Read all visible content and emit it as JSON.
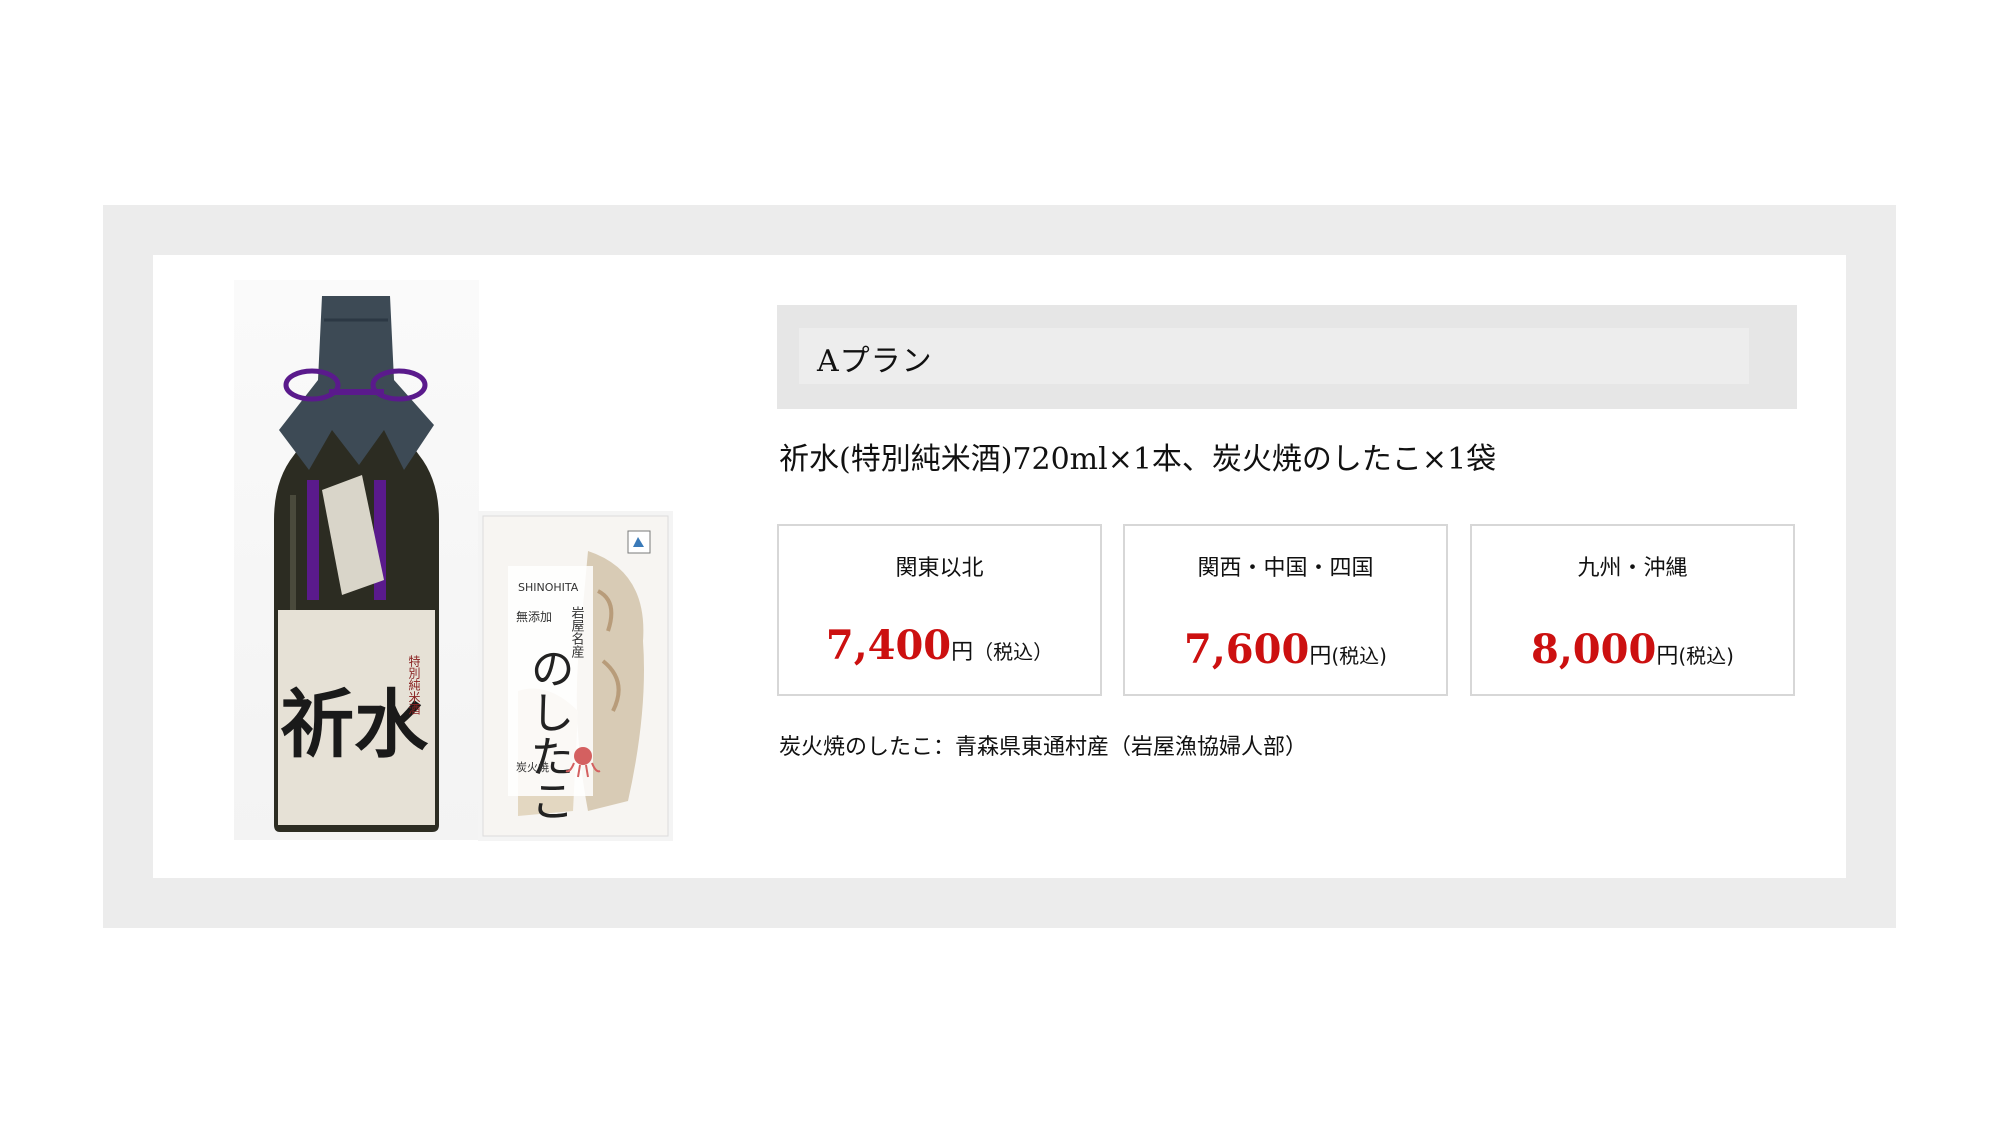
{
  "plan": {
    "title": "Aプラン",
    "description": "祈水(特別純米酒)720ml×1本、炭火焼のしたこ×1袋"
  },
  "prices": [
    {
      "region": "関東以北",
      "amount": "7,400",
      "unit": "円",
      "tax": "（税込）"
    },
    {
      "region": "関西・中国・四国",
      "amount": "7,600",
      "unit": "円",
      "tax": "(税込)"
    },
    {
      "region": "九州・沖縄",
      "amount": "8,000",
      "unit": "円",
      "tax": "(税込)"
    }
  ],
  "origin_note": "炭火焼のしたこ：青森県東通村産（岩屋漁協婦人部）",
  "bottle_label": {
    "main": "祈水",
    "sub": "特別純米酒"
  },
  "snack_label": {
    "brand": "SHINOHITA",
    "main": "のしたこ",
    "top": "岩屋名産",
    "additive_free": "無添加",
    "method": "炭火焼"
  },
  "colors": {
    "frame": "#ececec",
    "header": "#e6e6e6",
    "price": "#cc1010",
    "box_border": "#d7d7d7",
    "tassel": "#5a1a8c"
  }
}
